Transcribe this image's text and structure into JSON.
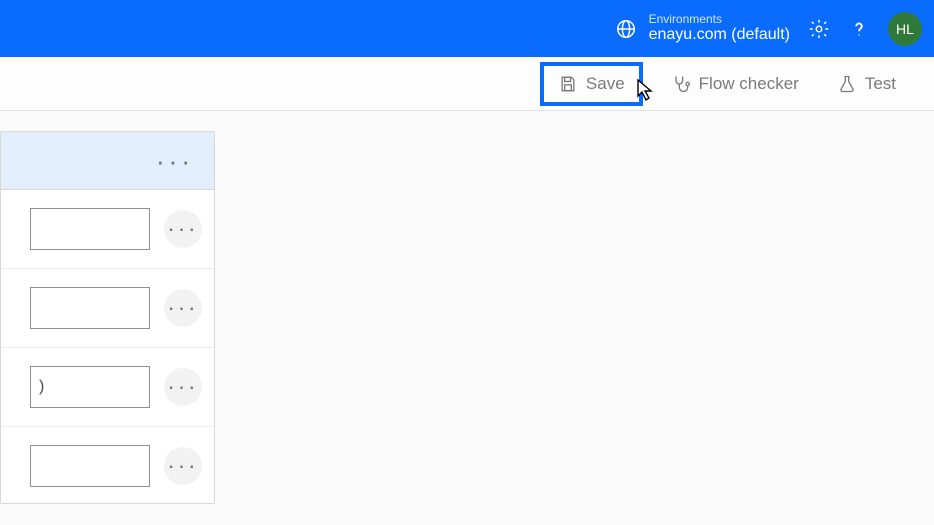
{
  "header": {
    "env_label": "Environments",
    "env_value": "enayu.com (default)",
    "avatar_initials": "HL"
  },
  "toolbar": {
    "save_label": "Save",
    "flow_checker_label": "Flow checker",
    "test_label": "Test"
  },
  "card": {
    "rows": [
      {
        "value": ""
      },
      {
        "value": ""
      },
      {
        "value": ")"
      },
      {
        "value": ""
      }
    ]
  }
}
